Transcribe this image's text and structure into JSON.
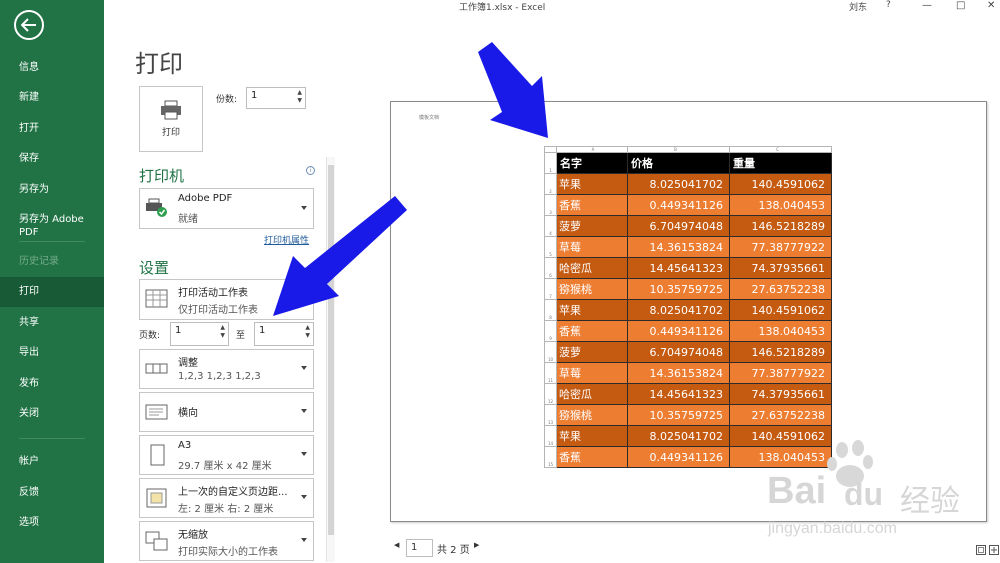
{
  "window": {
    "title": "工作簿1.xlsx - Excel",
    "user": "刘东",
    "help": "?",
    "minimize": "—",
    "restore": "□",
    "close": "✕"
  },
  "nav": {
    "items": [
      {
        "label": "信息"
      },
      {
        "label": "新建"
      },
      {
        "label": "打开"
      },
      {
        "label": "保存"
      },
      {
        "label": "另存为"
      },
      {
        "label": "另存为 Adobe PDF"
      },
      {
        "label": "历史记录"
      },
      {
        "label": "打印"
      },
      {
        "label": "共享"
      },
      {
        "label": "导出"
      },
      {
        "label": "发布"
      },
      {
        "label": "关闭"
      },
      {
        "label": "帐户"
      },
      {
        "label": "反馈"
      },
      {
        "label": "选项"
      }
    ],
    "active": "打印"
  },
  "print": {
    "title": "打印",
    "button_label": "打印",
    "copies_label": "份数:",
    "copies_value": "1",
    "printer_heading": "打印机",
    "printer_name": "Adobe PDF",
    "printer_status": "就绪",
    "printer_properties": "打印机属性",
    "settings_heading": "设置",
    "settings": [
      {
        "main": "打印活动工作表",
        "sub": "仅打印活动工作表"
      },
      {
        "main": "调整",
        "sub": "1,2,3    1,2,3    1,2,3"
      },
      {
        "main": "横向",
        "sub": ""
      },
      {
        "main": "A3",
        "sub": "29.7 厘米 x 42 厘米"
      },
      {
        "main": "上一次的自定义页边距...",
        "sub": "左: 2 厘米    右: 2 厘米"
      },
      {
        "main": "无缩放",
        "sub": "打印实际大小的工作表"
      }
    ],
    "pages_label": "页数:",
    "pages_from": "1",
    "to_label": "至",
    "pages_to": "1"
  },
  "preview": {
    "header_text": "模板文档",
    "column_letters": [
      "A",
      "B",
      "C"
    ],
    "table": {
      "headers": [
        "名字",
        "价格",
        "重量"
      ],
      "rows": [
        [
          "苹果",
          "8.025041702",
          "140.4591062"
        ],
        [
          "香蕉",
          "0.449341126",
          "138.040453"
        ],
        [
          "菠萝",
          "6.704974048",
          "146.5218289"
        ],
        [
          "草莓",
          "14.36153824",
          "77.38777922"
        ],
        [
          "哈密瓜",
          "14.45641323",
          "74.37935661"
        ],
        [
          "猕猴桃",
          "10.35759725",
          "27.63752238"
        ],
        [
          "苹果",
          "8.025041702",
          "140.4591062"
        ],
        [
          "香蕉",
          "0.449341126",
          "138.040453"
        ],
        [
          "菠萝",
          "6.704974048",
          "146.5218289"
        ],
        [
          "草莓",
          "14.36153824",
          "77.38777922"
        ],
        [
          "哈密瓜",
          "14.45641323",
          "74.37935661"
        ],
        [
          "猕猴桃",
          "10.35759725",
          "27.63752238"
        ],
        [
          "苹果",
          "8.025041702",
          "140.4591062"
        ],
        [
          "香蕉",
          "0.449341126",
          "138.040453"
        ]
      ]
    },
    "current_page": "1",
    "total_pages": "共 2 页"
  },
  "watermark": {
    "brand": "Bai",
    "brand2": "du",
    "sub": "经验",
    "url": "jingyan.baidu.com"
  },
  "colors": {
    "excel_green": "#217346",
    "row_dark": "#c55a11",
    "row_light": "#ed7d31",
    "annotation_arrow": "#1a1ae8"
  }
}
